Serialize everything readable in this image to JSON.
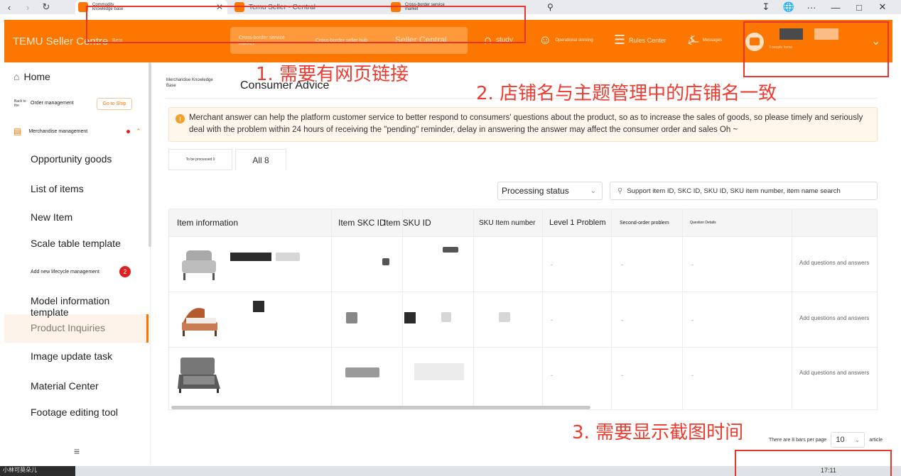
{
  "browser": {
    "tabs": [
      {
        "title": "Commodity knowledge base"
      },
      {
        "title": "Temu Seller - Central"
      },
      {
        "title": "Cross-border service market"
      }
    ]
  },
  "header": {
    "brand": "TEMU Seller Centre",
    "beta": "Beta",
    "pills": [
      "Cross-border service market",
      "Cross-border seller hub",
      "Seller Central"
    ],
    "links": [
      {
        "label": "study",
        "icon": "study-icon"
      },
      {
        "label": "Operational docking",
        "icon": "docking-icon"
      },
      {
        "label": "Rules Center",
        "icon": "rules-icon"
      },
      {
        "label": "Messages",
        "icon": "bell-icon"
      }
    ],
    "account_sub": "3 people home"
  },
  "annotations": {
    "a1": "1. 需要有网页链接",
    "a2": "2. 店铺名与主题管理中的店铺名一致",
    "a3": "3. 需要显示截图时间"
  },
  "sidebar": {
    "home": "Home",
    "back": "Back to the",
    "order": "Order management",
    "go_to_ship": "Go to Ship",
    "merchandise": "Merchandise management",
    "items": [
      "Opportunity goods",
      "List of items",
      "New Item",
      "Scale table template",
      "Add new lifecycle management",
      "Model information template",
      "Product Inquiries",
      "Image update task",
      "Material Center",
      "Footage editing tool"
    ],
    "badge": "2"
  },
  "main": {
    "breadcrumb": "Merchandise Knowledge Base",
    "title": "Consumer Advice",
    "notice": "Merchant answer can help the platform customer service to better respond to consumers' questions about the product, so as to increase the sales of goods, so please timely and seriously deal with the problem within 24 hours of receiving the \"pending\" reminder, delay in answering the answer may affect the consumer order and sales Oh ~",
    "tabs": [
      "To be processed 0",
      "All 8"
    ],
    "filter": "Processing status",
    "search_placeholder": "Support item ID, SKC ID, SKU ID, SKU item number, item name search",
    "columns": [
      "Item information",
      "Item SKC ID",
      "Item SKU ID",
      "SKU Item number",
      "Level 1 Problem",
      "Second-order problem",
      "Question Details"
    ],
    "rows": [
      {
        "level1": "-",
        "level2": "-",
        "details": "-",
        "action": "Add questions and answers"
      },
      {
        "level1": "-",
        "level2": "-",
        "details": "-",
        "action": "Add questions and answers"
      },
      {
        "level1": "-",
        "level2": "-",
        "details": "-",
        "action": "Add questions and answers"
      }
    ],
    "pager_text": "There are 8 bars per page",
    "page_size": "10",
    "pager_suffix": "article"
  },
  "taskbar": {
    "left": "小林可莫朵儿",
    "clock": "17:11"
  }
}
